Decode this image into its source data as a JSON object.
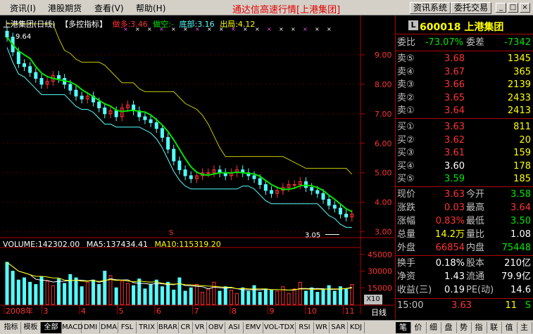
{
  "menubar": {
    "items": [
      "资讯(I)",
      "港股期货",
      "查看(V)",
      "帮助(H)"
    ],
    "app_title": "通达信高速行情[上港集团]",
    "btn_info": "资讯系统",
    "btn_trade": "委托交易",
    "min_glyph": "_",
    "restore_glyph": "□",
    "close_glyph": "×"
  },
  "chart": {
    "title": "上港集团(日线)",
    "indicator": "【多控指标】",
    "buy_label": "做多:3.46",
    "short_label": "做空:-",
    "bottom_label": "底部:3.16",
    "out_label": "出局:4.12",
    "high_marker": "9.64",
    "low_marker": "3.05",
    "marker_s": "S",
    "volume_label": "VOLUME:142302.00",
    "ma5_label": "MA5:137434.41",
    "ma10_label": "MA10:115319.20",
    "x10_label": "X10",
    "period_label": "日线",
    "colors": {
      "up": "#ff3232",
      "down": "#54ffff",
      "ma": "#00e600",
      "out": "#c8c800",
      "axis": "#b00000"
    }
  },
  "chart_data": {
    "type": "candlestick",
    "price_axis": [
      "9.00",
      "8.00",
      "7.00",
      "6.00",
      "5.00",
      "4.00",
      "3.00"
    ],
    "volume_axis": [
      "45000",
      "30000",
      "15000"
    ],
    "x_labels": [
      "2008年",
      "3",
      "4",
      "5",
      "6",
      "7",
      "8",
      "9",
      "10",
      "11"
    ],
    "ylim": [
      2.8,
      10.0
    ],
    "closes": [
      9.6,
      9.1,
      8.7,
      8.6,
      8.4,
      8.2,
      8.0,
      8.1,
      8.3,
      8.2,
      8.0,
      7.8,
      7.6,
      7.5,
      7.6,
      7.4,
      7.2,
      7.0,
      7.1,
      6.9,
      7.2,
      7.3,
      7.1,
      6.9,
      6.8,
      6.7,
      6.5,
      6.2,
      5.8,
      5.4,
      5.1,
      4.9,
      4.8,
      4.9,
      5.0,
      5.0,
      5.1,
      5.0,
      4.9,
      5.0,
      5.1,
      5.0,
      4.9,
      4.8,
      4.6,
      4.4,
      4.3,
      4.4,
      4.5,
      4.6,
      4.6,
      4.7,
      4.5,
      4.4,
      4.3,
      4.1,
      3.9,
      3.8,
      3.6,
      3.5,
      3.6
    ],
    "volumes": [
      38000,
      30000,
      22000,
      24000,
      20000,
      18000,
      25000,
      21000,
      17000,
      23000,
      19000,
      27000,
      24000,
      16000,
      20000,
      22000,
      18000,
      30000,
      26000,
      15000,
      21000,
      19000,
      17000,
      23000,
      14000,
      18000,
      22000,
      16000,
      20000,
      13000,
      24000,
      12000,
      15000,
      18000,
      11000,
      14000,
      20000,
      12000,
      16000,
      13000,
      10000,
      15000,
      12000,
      17000,
      11000,
      14000,
      13000,
      12000,
      16000,
      10000,
      14000,
      20000,
      12000,
      15000,
      11000,
      13000,
      17000,
      12000,
      16000,
      14000,
      18000
    ]
  },
  "quote": {
    "code": "600018",
    "name": "上港集团",
    "code_box": "L",
    "weibi_label": "委比",
    "weibi_value": "-73.07%",
    "weicha_label": "委差",
    "weicha_value": "-7342",
    "sells": [
      {
        "label": "卖⑤",
        "price": "3.68",
        "vol": "1345"
      },
      {
        "label": "卖④",
        "price": "3.67",
        "vol": "365"
      },
      {
        "label": "卖③",
        "price": "3.66",
        "vol": "2139"
      },
      {
        "label": "卖②",
        "price": "3.65",
        "vol": "2433"
      },
      {
        "label": "卖①",
        "price": "3.64",
        "vol": "2413"
      }
    ],
    "buys": [
      {
        "label": "买①",
        "price": "3.63",
        "vol": "811"
      },
      {
        "label": "买②",
        "price": "3.62",
        "vol": "20"
      },
      {
        "label": "买③",
        "price": "3.61",
        "vol": "159"
      },
      {
        "label": "买④",
        "price": "3.60",
        "vol": "178"
      },
      {
        "label": "买⑤",
        "price": "3.59",
        "vol": "185"
      }
    ],
    "stats1": [
      {
        "l1": "现价",
        "v1": "3.63",
        "l2": "今开",
        "v2": "3.58"
      },
      {
        "l1": "涨跌",
        "v1": "0.03",
        "l2": "最高",
        "v2": "3.64"
      },
      {
        "l1": "涨幅",
        "v1": "0.83%",
        "l2": "最低",
        "v2": "3.50"
      },
      {
        "l1": "总量",
        "v1": "14.2万",
        "l2": "量比",
        "v2": "1.08"
      },
      {
        "l1": "外盘",
        "v1": "66854",
        "l2": "内盘",
        "v2": "75448"
      }
    ],
    "stats2": [
      {
        "l1": "换手",
        "v1": "0.18%",
        "l2": "股本",
        "v2": "210亿"
      },
      {
        "l1": "净资",
        "v1": "1.43",
        "l2": "流通",
        "v2": "79.9亿"
      },
      {
        "l1": "收益(三)",
        "v1": "0.19",
        "l2": "PE(动)",
        "v2": "14.6"
      }
    ],
    "tick": {
      "time": "15:00",
      "price": "3.63",
      "vol": "11",
      "flag": "S"
    }
  },
  "tabs": [
    "指标",
    "模板",
    "全部",
    "MACD",
    "DMI",
    "DMA",
    "FSL",
    "TRIX",
    "BRAR",
    "CR",
    "VR",
    "OBV",
    "ASI",
    "EMV",
    "VOL-TDX",
    "RSI",
    "WR",
    "SAR",
    "KDJ"
  ],
  "right_tabs": [
    "笔",
    "价",
    "细",
    "盘",
    "势",
    "指",
    "联",
    "值",
    "主"
  ]
}
